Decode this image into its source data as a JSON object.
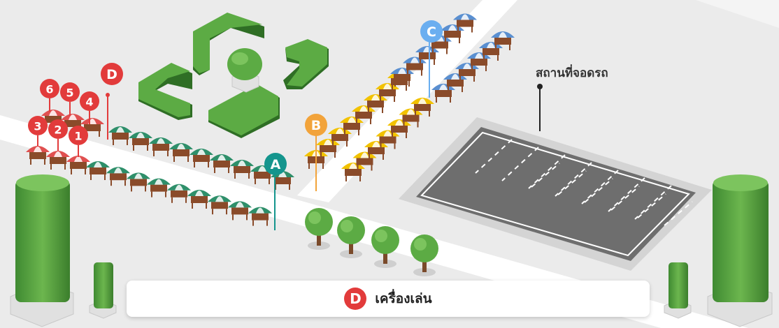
{
  "map": {
    "colors": {
      "ground": "#ebebeb",
      "road": "#ffffff",
      "hedge": "#4e9a3a",
      "hedge_dark": "#2f6e25",
      "parking_lot": "#6e6e6e",
      "parking_border": "#d0d0d0",
      "umbrella_green": "#2e8f6a",
      "umbrella_yellow": "#f2c200",
      "umbrella_blue": "#5a8fd0",
      "umbrella_red": "#e05050",
      "stall": "#8a4b2a"
    },
    "zones": [
      {
        "letter": "A",
        "color": "#14958d"
      },
      {
        "letter": "B",
        "color": "#f2a33a"
      },
      {
        "letter": "C",
        "color": "#6aaef0"
      }
    ],
    "playground_marker": {
      "letter": "D",
      "color": "#e23b3b"
    },
    "numbered_markers": [
      {
        "label": "1",
        "color": "#e23b3b"
      },
      {
        "label": "2",
        "color": "#e23b3b"
      },
      {
        "label": "3",
        "color": "#e23b3b"
      },
      {
        "label": "4",
        "color": "#e23b3b"
      },
      {
        "label": "5",
        "color": "#e23b3b"
      },
      {
        "label": "6",
        "color": "#e23b3b"
      }
    ],
    "parking": {
      "label": "สถานที่จอดรถ"
    },
    "legend": {
      "badge": "D",
      "badge_color": "#e23b3b",
      "text": "เครื่องเล่น"
    }
  }
}
